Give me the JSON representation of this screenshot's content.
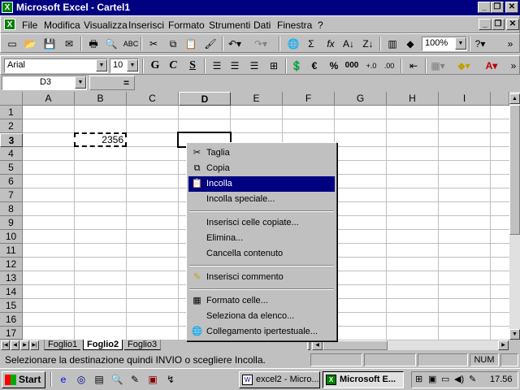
{
  "window": {
    "title": "Microsoft Excel - Cartel1",
    "app_icon": "excel-icon"
  },
  "menu": [
    {
      "label": "File",
      "u": "F"
    },
    {
      "label": "Modifica",
      "u": "M"
    },
    {
      "label": "Visualizza",
      "u": "V"
    },
    {
      "label": "Inserisci",
      "u": "I"
    },
    {
      "label": "Formato",
      "u": "o"
    },
    {
      "label": "Strumenti",
      "u": "S"
    },
    {
      "label": "Dati",
      "u": "D"
    },
    {
      "label": "Finestra",
      "u": "n"
    },
    {
      "label": "?",
      "u": "?"
    }
  ],
  "toolbar": {
    "zoom": "100%"
  },
  "format": {
    "font": "Arial",
    "size": "10",
    "bold": "G",
    "italic": "C",
    "underline": "S",
    "currency": "€",
    "percent": "%",
    "thousands": "000"
  },
  "formula": {
    "namebox": "D3",
    "equals": "="
  },
  "columns": [
    "A",
    "B",
    "C",
    "D",
    "E",
    "F",
    "G",
    "H",
    "I"
  ],
  "rows": [
    "1",
    "2",
    "3",
    "4",
    "5",
    "6",
    "7",
    "8",
    "9",
    "10",
    "11",
    "12",
    "13",
    "14",
    "15",
    "16",
    "17"
  ],
  "cells": {
    "B3": "2356"
  },
  "context_menu": {
    "items": [
      {
        "label": "Taglia",
        "icon": "scissors-icon"
      },
      {
        "label": "Copia",
        "icon": "copy-icon"
      },
      {
        "label": "Incolla",
        "icon": "paste-icon",
        "selected": true
      },
      {
        "label": "Incolla speciale..."
      },
      {
        "label": "Inserisci celle copiate..."
      },
      {
        "label": "Elimina..."
      },
      {
        "label": "Cancella contenuto"
      },
      {
        "label": "Inserisci commento",
        "icon": "comment-icon"
      },
      {
        "label": "Formato celle...",
        "icon": "format-cells-icon"
      },
      {
        "label": "Seleziona da elenco..."
      },
      {
        "label": "Collegamento ipertestuale...",
        "icon": "hyperlink-icon"
      }
    ]
  },
  "sheets": [
    "Foglio1",
    "Foglio2",
    "Foglio3"
  ],
  "active_sheet": "Foglio2",
  "status": {
    "message": "Selezionare la destinazione quindi INVIO o scegliere Incolla.",
    "num": "NUM"
  },
  "taskbar": {
    "start": "Start",
    "tasks": [
      "excel2 - Micro...",
      "Microsoft E..."
    ],
    "active_task": "Microsoft E...",
    "clock": "17.56"
  }
}
